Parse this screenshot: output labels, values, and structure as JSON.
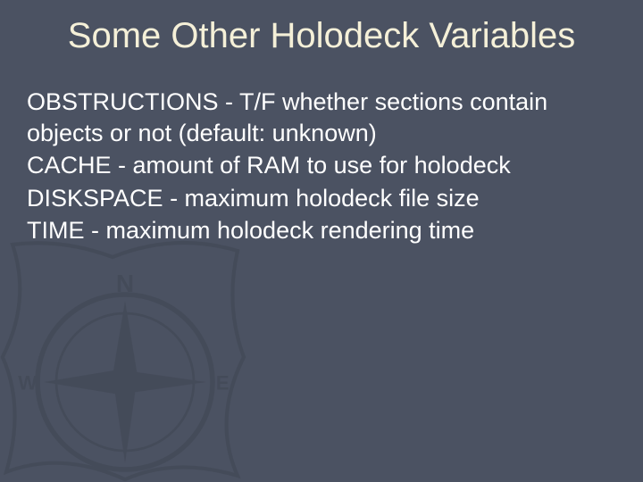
{
  "title": "Some Other Holodeck Variables",
  "entries": [
    {
      "term": "OBSTRUCTIONS",
      "desc": " - T/F whether sections contain objects or not (default: unknown)"
    },
    {
      "term": "CACHE",
      "desc": " - amount of RAM to use for holodeck"
    },
    {
      "term": "DISKSPACE",
      "desc": " - maximum holodeck file size"
    },
    {
      "term": "TIME",
      "desc": " - maximum holodeck rendering time"
    }
  ]
}
